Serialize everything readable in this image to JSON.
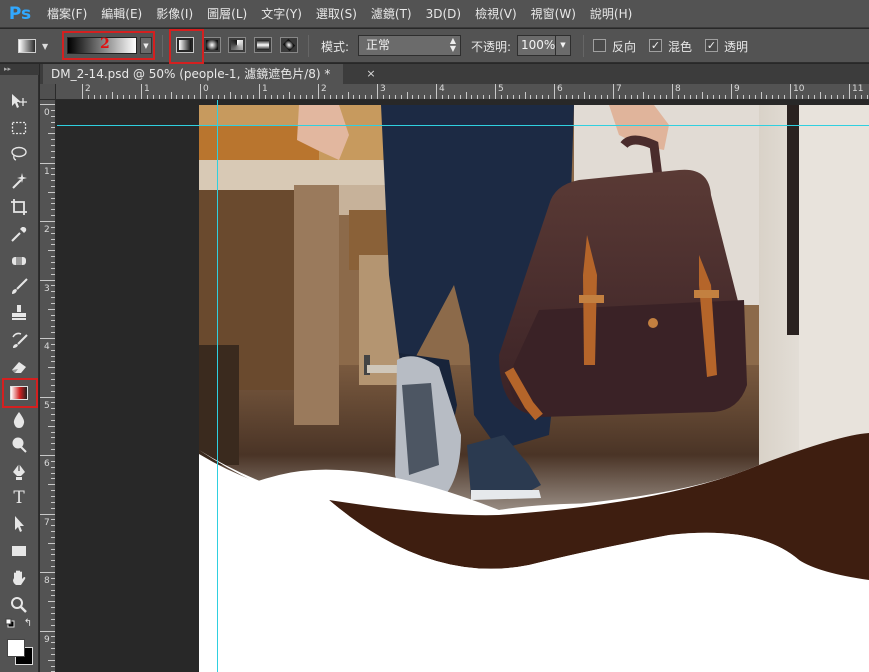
{
  "app": {
    "logo": "Ps"
  },
  "menu": [
    "檔案(F)",
    "編輯(E)",
    "影像(I)",
    "圖層(L)",
    "文字(Y)",
    "選取(S)",
    "濾鏡(T)",
    "3D(D)",
    "檢視(V)",
    "視窗(W)",
    "說明(H)"
  ],
  "options": {
    "callout_number": "2",
    "mode_label": "模式:",
    "mode_value": "正常",
    "opacity_label": "不透明:",
    "opacity_value": "100%",
    "reverse_label": "反向",
    "dither_label": "混色",
    "transparency_label": "透明",
    "reverse_checked": false,
    "dither_checked": true,
    "transparency_checked": true
  },
  "document": {
    "tab_title": "DM_2-14.psd @ 50% (people-1, 濾鏡遮色片/8) *",
    "close_glyph": "×"
  },
  "ruler": {
    "h_labels": [
      "2",
      "1",
      "0",
      "1",
      "2",
      "3",
      "4",
      "5",
      "6",
      "7",
      "8",
      "9",
      "10",
      "11"
    ],
    "v_labels": [
      "0",
      "1",
      "2",
      "3",
      "4",
      "5",
      "6",
      "7",
      "8",
      "9"
    ]
  },
  "colors": {
    "ps_blue": "#31a8ff",
    "highlight_red": "#d42020",
    "guide": "#2fd0e0",
    "brown_wave": "#3e1e10"
  },
  "toolbar": {
    "header": "▸▸",
    "icons": [
      "move-icon",
      "marquee-icon",
      "lasso-icon",
      "magic-wand-icon",
      "crop-icon",
      "eyedropper-icon",
      "healing-brush-icon",
      "brush-icon",
      "clone-stamp-icon",
      "history-brush-icon",
      "eraser-icon",
      "gradient-icon",
      "blur-icon",
      "dodge-icon",
      "pen-icon",
      "type-icon",
      "path-selection-icon",
      "rectangle-icon",
      "hand-icon",
      "zoom-icon"
    ]
  }
}
